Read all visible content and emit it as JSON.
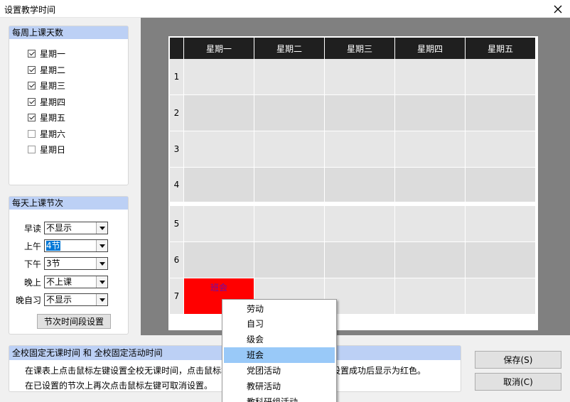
{
  "window": {
    "title": "设置教学时间"
  },
  "weekdays_group": {
    "header": "每周上课天数",
    "days": [
      {
        "label": "星期一",
        "checked": true
      },
      {
        "label": "星期二",
        "checked": true
      },
      {
        "label": "星期三",
        "checked": true
      },
      {
        "label": "星期四",
        "checked": true
      },
      {
        "label": "星期五",
        "checked": true
      },
      {
        "label": "星期六",
        "checked": false
      },
      {
        "label": "星期日",
        "checked": false
      }
    ]
  },
  "periods_group": {
    "header": "每天上课节次",
    "rows": [
      {
        "label": "早读",
        "value": "不显示"
      },
      {
        "label": "上午",
        "value": "4节"
      },
      {
        "label": "下午",
        "value": "3节"
      },
      {
        "label": "晚上",
        "value": "不上课"
      },
      {
        "label": "晚自习",
        "value": "不显示"
      }
    ],
    "setting_button": "节次时间段设置"
  },
  "schedule": {
    "days": [
      "星期一",
      "星期二",
      "星期三",
      "星期四",
      "星期五"
    ],
    "periods": [
      "1",
      "2",
      "3",
      "4",
      "5",
      "6",
      "7"
    ],
    "marked_cell": {
      "text": "班会",
      "color": "#ff0000"
    }
  },
  "info": {
    "header": "全校固定无课时间 和 全校固定活动时间",
    "line1": "在课表上点击鼠标左键设置全校无课时间，点击鼠标右键设置全校固定活动时间，设置成功后显示为红色。",
    "line2": "在已设置的节次上再次点击鼠标左键可取消设置。"
  },
  "buttons": {
    "save": "保存(S)",
    "cancel": "取消(C)"
  },
  "context_menu": {
    "items": [
      "劳动",
      "自习",
      "级会",
      "班会",
      "党团活动",
      "教研活动",
      "教科研组活动"
    ],
    "highlighted": "班会"
  },
  "colors": {
    "header_blue": "#bcd0f5",
    "table_header": "#1f1f1f",
    "menu_highlight": "#99c9f8",
    "marked": "#ff0000"
  }
}
